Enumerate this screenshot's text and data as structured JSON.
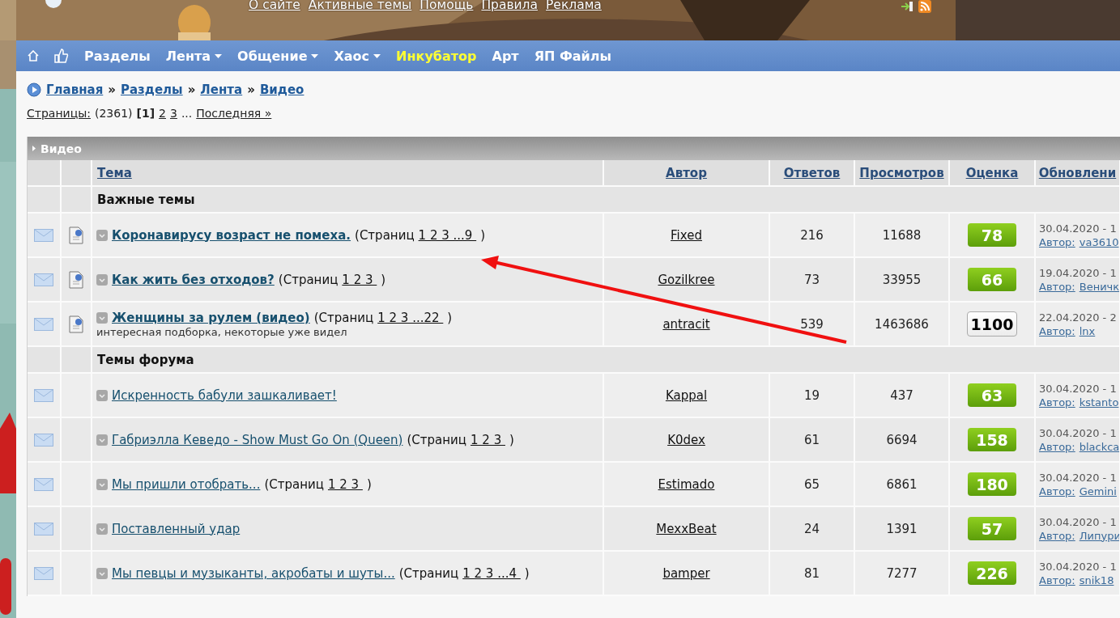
{
  "header": {
    "links": [
      "О сайте",
      "Активные темы",
      "Помощь",
      "Правила",
      "Реклама"
    ]
  },
  "nav": [
    {
      "kind": "home"
    },
    {
      "kind": "like"
    },
    {
      "kind": "link",
      "label": "Разделы",
      "dropdown": false,
      "highlighted": false
    },
    {
      "kind": "link",
      "label": "Лента",
      "dropdown": true,
      "highlighted": false
    },
    {
      "kind": "link",
      "label": "Общение",
      "dropdown": true,
      "highlighted": false
    },
    {
      "kind": "link",
      "label": "Хаос",
      "dropdown": true,
      "highlighted": false
    },
    {
      "kind": "link",
      "label": "Инкубатор",
      "dropdown": false,
      "highlighted": true
    },
    {
      "kind": "link",
      "label": "Арт",
      "dropdown": false,
      "highlighted": false
    },
    {
      "kind": "link",
      "label": "ЯП Файлы",
      "dropdown": false,
      "highlighted": false
    }
  ],
  "breadcrumb": [
    {
      "kind": "link",
      "text": "Главная"
    },
    {
      "kind": "sep",
      "text": "»"
    },
    {
      "kind": "link",
      "text": "Разделы"
    },
    {
      "kind": "sep",
      "text": "»"
    },
    {
      "kind": "link",
      "text": "Лента"
    },
    {
      "kind": "sep",
      "text": "»"
    },
    {
      "kind": "link",
      "text": "Видео"
    }
  ],
  "pagination": {
    "label": "Страницы:",
    "count": "(2361)",
    "current": "[1]",
    "pages": [
      "2",
      "3"
    ],
    "ellipsis": "...",
    "last": "Последняя »"
  },
  "forum": {
    "title": "Видео",
    "columns": [
      "Тема",
      "Автор",
      "Ответов",
      "Просмотров",
      "Оценка",
      "Обновлени"
    ],
    "sections": [
      {
        "title": "Важные темы",
        "topics": [
          {
            "pinned": true,
            "title": "Коронавирусу возраст не помеха.",
            "pages": {
              "prefix": "(Страниц",
              "links": "1 2 3 ...9",
              "suffix": ")"
            },
            "author": "Fixed",
            "replies": "216",
            "views": "11688",
            "rating": {
              "kind": "green",
              "value": "78"
            },
            "updated": "30.04.2020 - 1",
            "last_label": "Автор:",
            "last_author": "va3610"
          },
          {
            "pinned": true,
            "title": "Как жить без отходов?",
            "pages": {
              "prefix": "(Страниц",
              "links": "1 2 3",
              "suffix": ")"
            },
            "author": "Gozilkree",
            "replies": "73",
            "views": "33955",
            "rating": {
              "kind": "green",
              "value": "66"
            },
            "updated": "19.04.2020 - 1",
            "last_label": "Автор:",
            "last_author": "Веничк"
          },
          {
            "pinned": true,
            "title": "Женщины за рулем (видео)",
            "pages": {
              "prefix": "(Страниц",
              "links": "1 2 3 ...22",
              "suffix": ")"
            },
            "description": "интересная подборка, некоторые уже видел",
            "author": "antracit",
            "replies": "539",
            "views": "1463686",
            "rating": {
              "kind": "plain",
              "value": "1100"
            },
            "updated": "22.04.2020 - 2",
            "last_label": "Автор:",
            "last_author": "lnx"
          }
        ]
      },
      {
        "title": "Темы форума",
        "topics": [
          {
            "pinned": false,
            "title": "Искренность бабули зашкаливает!",
            "author": "Kappal",
            "replies": "19",
            "views": "437",
            "rating": {
              "kind": "green",
              "value": "63"
            },
            "updated": "30.04.2020 - 1",
            "last_label": "Автор:",
            "last_author": "kstanto"
          },
          {
            "pinned": false,
            "title": "Габриэлла Кеведо - Show Must Go On (Queen)",
            "pages": {
              "prefix": "(Страниц",
              "links": "1 2 3",
              "suffix": ")"
            },
            "author": "K0dex",
            "replies": "61",
            "views": "6694",
            "rating": {
              "kind": "green",
              "value": "158"
            },
            "updated": "30.04.2020 - 1",
            "last_label": "Автор:",
            "last_author": "blackca"
          },
          {
            "pinned": false,
            "title": "Мы пришли отобрать...",
            "pages": {
              "prefix": "(Страниц",
              "links": "1 2 3",
              "suffix": ")"
            },
            "author": "Estimado",
            "replies": "65",
            "views": "6861",
            "rating": {
              "kind": "green",
              "value": "180"
            },
            "updated": "30.04.2020 - 1",
            "last_label": "Автор:",
            "last_author": "Gemini"
          },
          {
            "pinned": false,
            "title": "Поставленный удар",
            "author": "MexxBeat",
            "replies": "24",
            "views": "1391",
            "rating": {
              "kind": "green",
              "value": "57"
            },
            "updated": "30.04.2020 - 1",
            "last_label": "Автор:",
            "last_author": "Липури"
          },
          {
            "pinned": false,
            "title": "Мы певцы и музыканты, акробаты и шуты...",
            "pages": {
              "prefix": "(Страниц",
              "links": "1 2 3 ...4",
              "suffix": ")"
            },
            "author": "bamper",
            "replies": "81",
            "views": "7277",
            "rating": {
              "kind": "green",
              "value": "226"
            },
            "updated": "30.04.2020 - 1",
            "last_label": "Автор:",
            "last_author": "snik18"
          }
        ]
      }
    ]
  }
}
